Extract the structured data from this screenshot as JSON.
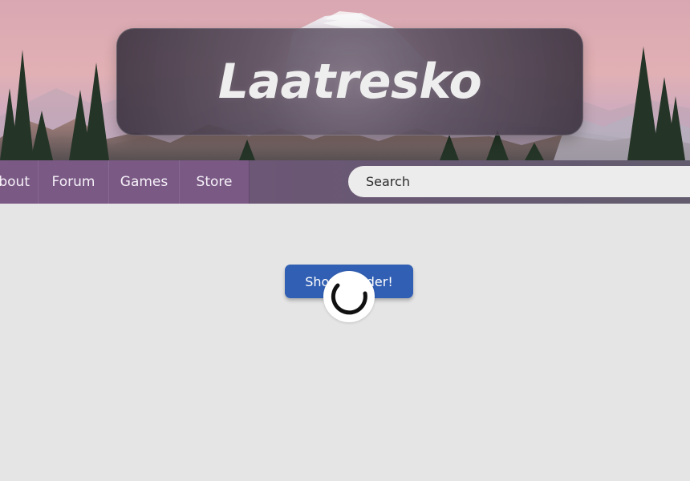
{
  "header": {
    "brand_title": "Laatresko"
  },
  "nav": {
    "items": [
      {
        "label": "bout"
      },
      {
        "label": "Forum"
      },
      {
        "label": "Games"
      },
      {
        "label": "Store"
      }
    ]
  },
  "search": {
    "placeholder": "Search",
    "value": ""
  },
  "main": {
    "button_label": "Show Loader!"
  },
  "loader": {
    "icon": "spinner-icon"
  },
  "colors": {
    "background": "#e5e5e5",
    "nav": "#76567f",
    "button": "#315fb3"
  }
}
